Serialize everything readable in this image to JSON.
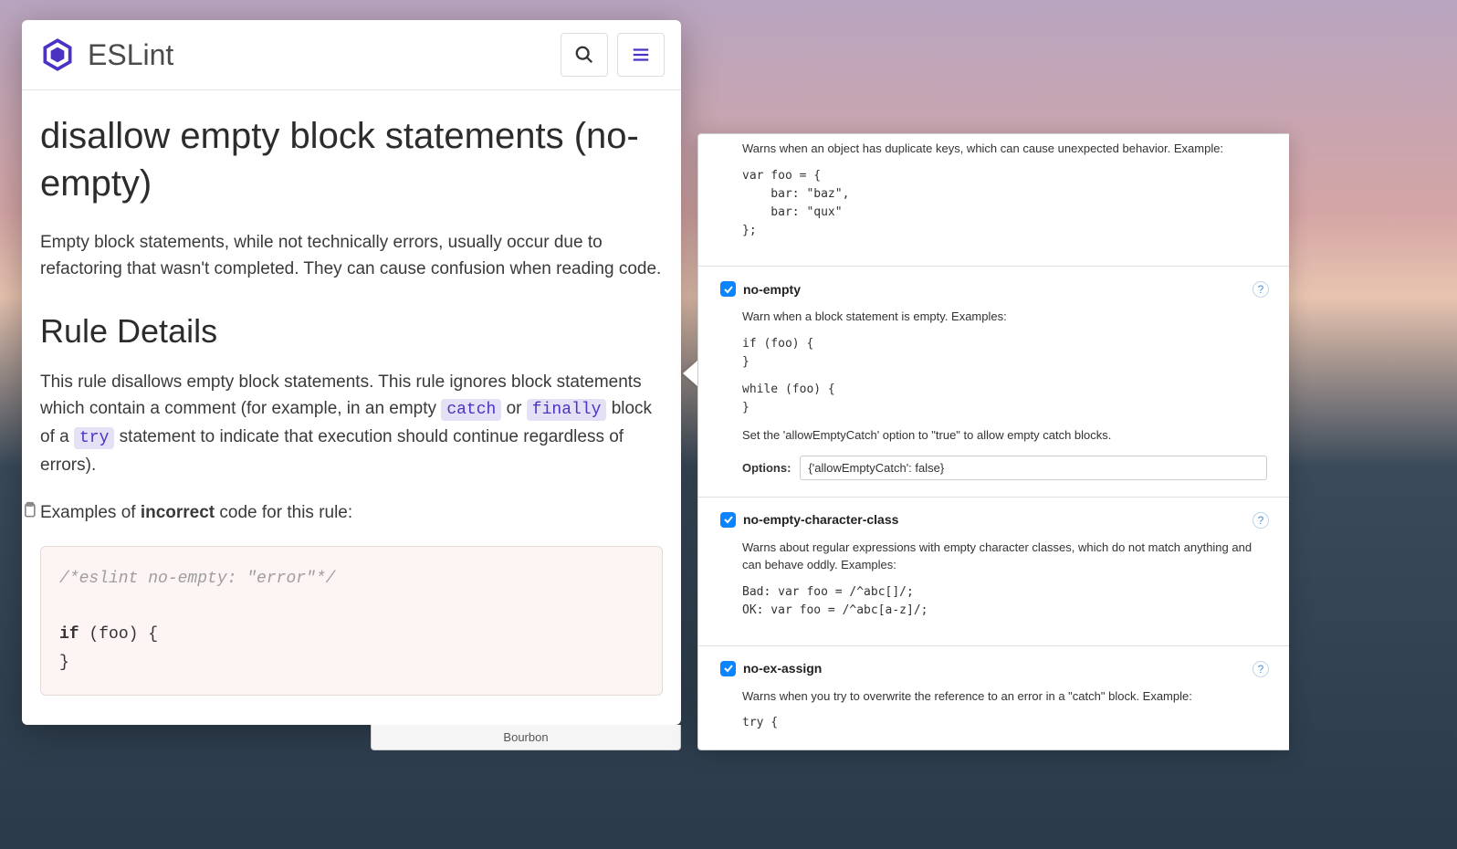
{
  "docs": {
    "brand": "ESLint",
    "title": "disallow empty block statements (no-empty)",
    "intro": "Empty block statements, while not technically errors, usually occur due to refactoring that wasn't completed. They can cause confusion when reading code.",
    "section_heading": "Rule Details",
    "details_pre": "This rule disallows empty block statements. This rule ignores block statements which contain a comment (for example, in an empty ",
    "kw_catch": "catch",
    "details_mid1": " or ",
    "kw_finally": "finally",
    "details_mid2": " block of a ",
    "kw_try": "try",
    "details_post": " statement to indicate that execution should continue regardless of errors).",
    "examples_pre": "Examples of ",
    "examples_strong": "incorrect",
    "examples_post": " code for this rule:",
    "code_comment": "/*eslint no-empty: \"error\"*/",
    "code_line1": "if (foo) {",
    "code_line2": "}"
  },
  "bourbon_tab": "Bourbon",
  "settings": {
    "dupe": {
      "desc": "Warns when an object has duplicate keys, which can cause unexpected behavior. Example:",
      "code": "var foo = {\n    bar: \"baz\",\n    bar: \"qux\"\n};"
    },
    "no_empty": {
      "name": "no-empty",
      "desc": "Warn when a block statement is empty. Examples:",
      "code1": "if (foo) {\n}",
      "code2": "while (foo) {\n}",
      "note": "Set the 'allowEmptyCatch' option to \"true\" to allow empty catch blocks.",
      "options_label": "Options:",
      "options_value": "{'allowEmptyCatch': false}"
    },
    "no_empty_cc": {
      "name": "no-empty-character-class",
      "desc": "Warns about regular expressions with empty character classes, which do not match anything and can behave oddly. Examples:",
      "code": "Bad: var foo = /^abc[]/;\nOK: var foo = /^abc[a-z]/;"
    },
    "no_ex_assign": {
      "name": "no-ex-assign",
      "desc": "Warns when you try to overwrite the reference to an error in a \"catch\" block. Example:",
      "code": "try {"
    }
  }
}
